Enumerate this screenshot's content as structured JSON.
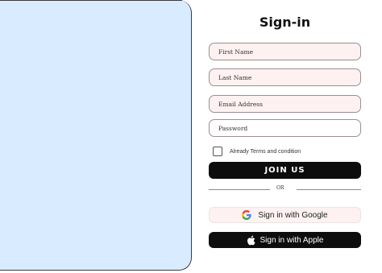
{
  "title": "Sign-in",
  "fields": {
    "first_name_placeholder": "First Name",
    "last_name_placeholder": "Last Name",
    "email_placeholder": "Email Address",
    "password_placeholder": "Password"
  },
  "terms": {
    "label": "Already Terms and condition",
    "checked": false
  },
  "join_label": "JOIN US",
  "divider_label": "OR",
  "google": {
    "label": "Sign in with Google",
    "icon": "google-icon"
  },
  "apple": {
    "label": "Sign in with Apple",
    "icon": "apple-icon"
  },
  "colors": {
    "panel_background": "#d8ebff",
    "field_background": "#fdf1f1",
    "button_dark": "#0d0d0d"
  }
}
